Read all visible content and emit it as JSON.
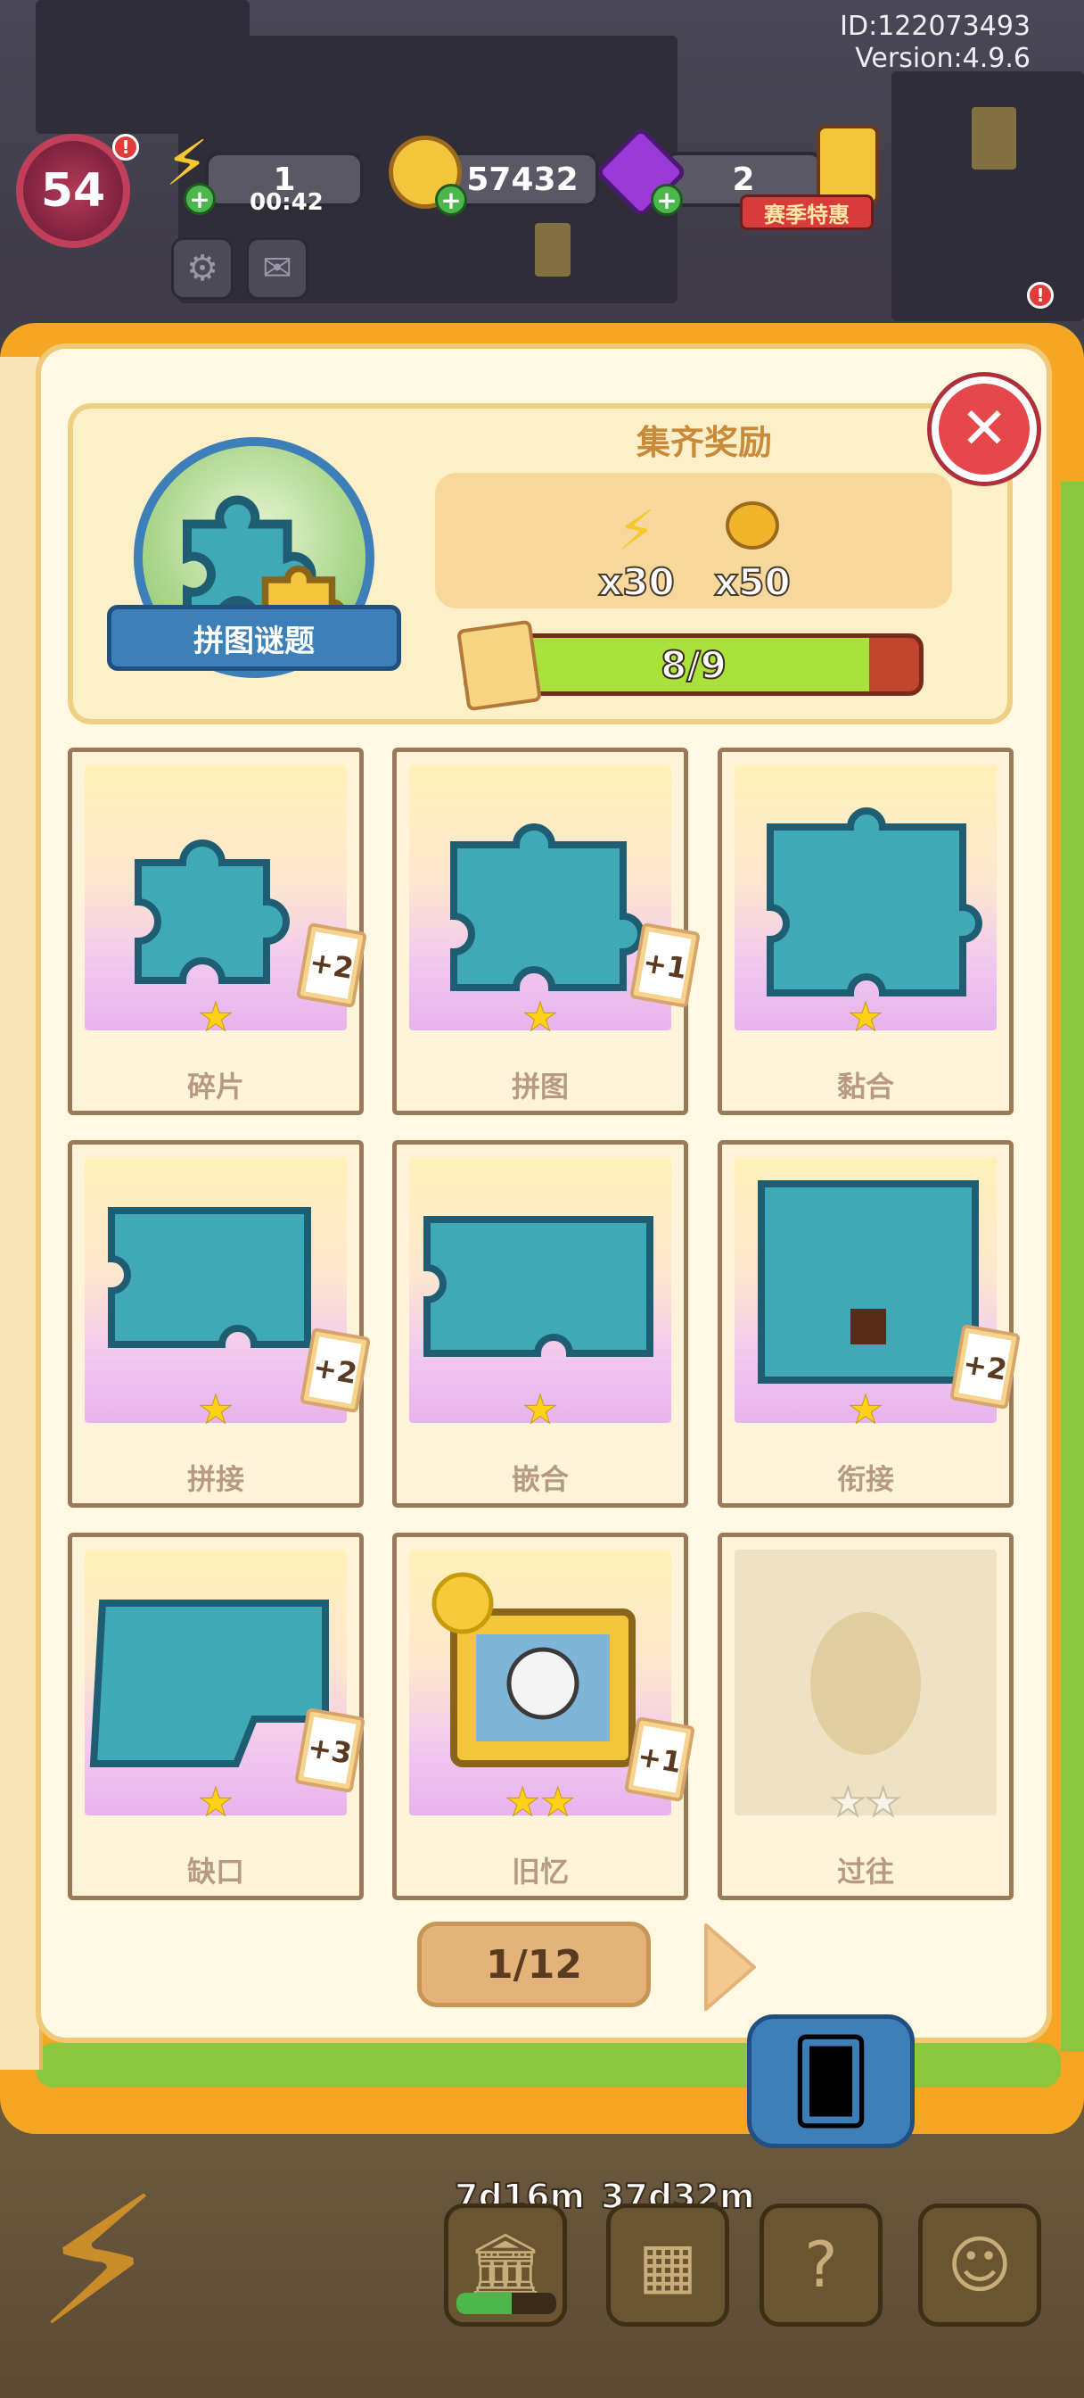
{
  "meta": {
    "id": "ID:122073493",
    "version": "Version:4.9.6"
  },
  "hud": {
    "level": "54",
    "energy": "1",
    "energy_timer": "00:42",
    "coins": "57432",
    "gems": "2",
    "promo_label": "赛季特惠"
  },
  "album": {
    "name": "拼图谜题",
    "reward_title": "集齐奖励",
    "rewards": [
      {
        "icon": "lightning-icon",
        "count": "x30"
      },
      {
        "icon": "coins-icon",
        "count": "x50"
      }
    ],
    "progress_text": "8/9",
    "progress_value": 0.889
  },
  "cards": [
    {
      "name": "碎片",
      "stars": 1,
      "badge": "+2",
      "locked": false
    },
    {
      "name": "拼图",
      "stars": 1,
      "badge": "+1",
      "locked": false
    },
    {
      "name": "黏合",
      "stars": 1,
      "badge": "",
      "locked": false
    },
    {
      "name": "拼接",
      "stars": 1,
      "badge": "+2",
      "locked": false
    },
    {
      "name": "嵌合",
      "stars": 1,
      "badge": "",
      "locked": false
    },
    {
      "name": "衔接",
      "stars": 1,
      "badge": "+2",
      "locked": false
    },
    {
      "name": "缺口",
      "stars": 1,
      "badge": "+3",
      "locked": false
    },
    {
      "name": "旧忆",
      "stars": 2,
      "badge": "+1",
      "locked": false
    },
    {
      "name": "过往",
      "stars": 2,
      "badge": "",
      "locked": true
    }
  ],
  "pagination": {
    "text": "1/12"
  },
  "dock": {
    "timer_1": "7d16m",
    "timer_2": "37d32m",
    "event_progress": 0.55
  },
  "colors": {
    "accent_orange": "#f5a623",
    "progress_green": "#a8e23a",
    "close_red": "#e6474b",
    "ribbon_blue": "#3c7fb9",
    "star_yellow": "#ffd21a"
  }
}
